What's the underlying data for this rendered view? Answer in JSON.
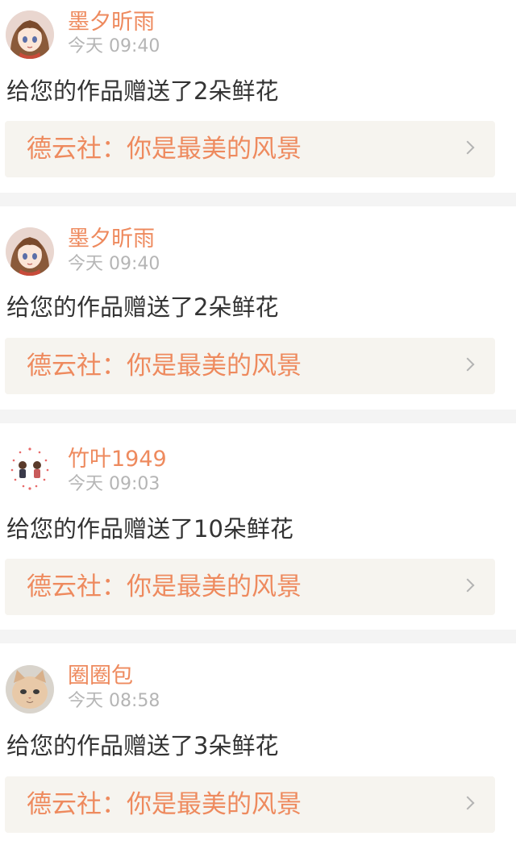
{
  "colors": {
    "accent": "#ee8a5e",
    "time": "#b5b5b5",
    "text": "#333333",
    "link_bg": "#f6f4ef",
    "separator": "#f4f4f4"
  },
  "notifications": [
    {
      "username": "墨夕昕雨",
      "time": "今天 09:40",
      "message": "给您的作品赠送了2朵鲜花",
      "work_title": "德云社：你是最美的风景",
      "avatar_icon": "anime-girl-avatar-icon"
    },
    {
      "username": "墨夕昕雨",
      "time": "今天 09:40",
      "message": "给您的作品赠送了2朵鲜花",
      "work_title": "德云社：你是最美的风景",
      "avatar_icon": "anime-girl-avatar-icon"
    },
    {
      "username": "竹叶1949",
      "time": "今天 09:03",
      "message": "给您的作品赠送了10朵鲜花",
      "work_title": "德云社：你是最美的风景",
      "avatar_icon": "couple-hearts-avatar-icon"
    },
    {
      "username": "圈圈包",
      "time": "今天 08:58",
      "message": "给您的作品赠送了3朵鲜花",
      "work_title": "德云社：你是最美的风景",
      "avatar_icon": "cat-avatar-icon"
    }
  ]
}
